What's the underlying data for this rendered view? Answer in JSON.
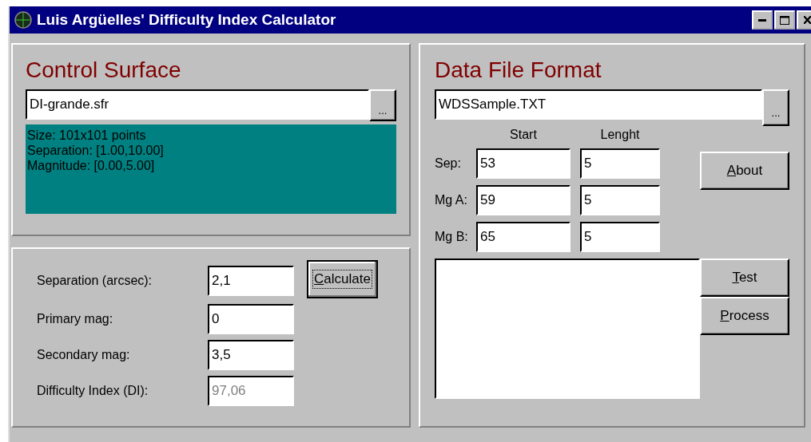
{
  "window": {
    "title": "Luis Argüelles' Difficulty Index Calculator"
  },
  "control_surface": {
    "heading": "Control Surface",
    "file": {
      "value": "DI-grande.sfr",
      "browse": "..."
    },
    "info": [
      "Size: 101x101 points",
      "Separation: [1.00,10.00]",
      "Magnitude: [0.00,5.00]"
    ]
  },
  "calculator": {
    "fields": [
      {
        "label": "Separation (arcsec):",
        "value": "2,1",
        "disabled": false
      },
      {
        "label": "Primary mag:",
        "value": "0",
        "disabled": false
      },
      {
        "label": "Secondary mag:",
        "value": "3,5",
        "disabled": false
      },
      {
        "label": "Difficulty Index (DI):",
        "value": "97,06",
        "disabled": true
      }
    ],
    "button": {
      "label": "Calculate",
      "focused": true
    }
  },
  "data_file_format": {
    "heading": "Data File Format",
    "file": {
      "value": "WDSSample.TXT",
      "browse": "..."
    },
    "columns": [
      "Start",
      "Lenght"
    ],
    "rows": [
      {
        "label": "Sep:",
        "start": "53",
        "length": "5"
      },
      {
        "label": "Mg A:",
        "start": "59",
        "length": "5"
      },
      {
        "label": "Mg B:",
        "start": "65",
        "length": "5"
      }
    ],
    "buttons": [
      {
        "label": "About",
        "focused": false
      },
      {
        "label": "Test",
        "focused": false
      },
      {
        "label": "Process",
        "focused": false
      }
    ]
  }
}
